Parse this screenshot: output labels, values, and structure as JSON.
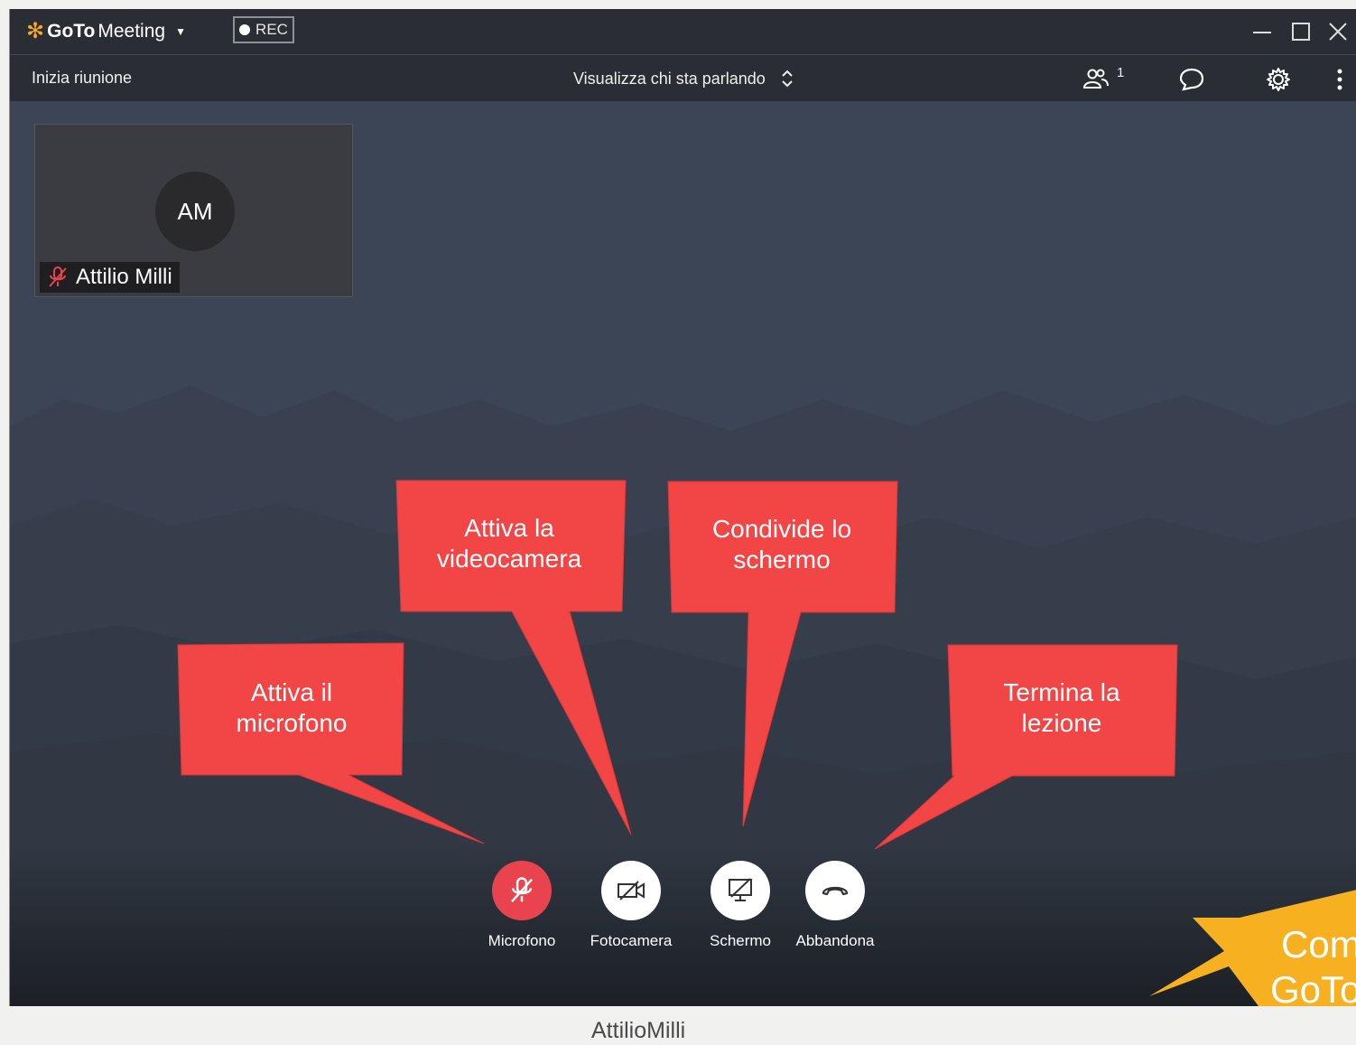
{
  "app": {
    "brand_bold": "GoTo",
    "brand_light": "Meeting",
    "rec_label": "REC"
  },
  "toolbar": {
    "start_meeting": "Inizia riunione",
    "view_mode": "Visualizza chi sta parlando",
    "participants_count": "1"
  },
  "participant": {
    "initials": "AM",
    "name": "Attilio Milli"
  },
  "callouts": {
    "mic": [
      "Attiva il",
      "microfono"
    ],
    "camera": [
      "Attiva la",
      "videocamera"
    ],
    "screen": [
      "Condivide lo",
      "schermo"
    ],
    "leave": [
      "Termina la",
      "lezione"
    ]
  },
  "controls": {
    "mic": "Microfono",
    "camera": "Fotocamera",
    "screen": "Schermo",
    "leave": "Abbandona"
  },
  "badge": [
    "Com",
    "GoTo"
  ],
  "caption": "AttilioMilli",
  "colors": {
    "titlebar": "#2a2d33",
    "stage": "#3c4555",
    "callout": "#f24545",
    "mic_active": "#e8434f",
    "badge": "#f6b020"
  }
}
